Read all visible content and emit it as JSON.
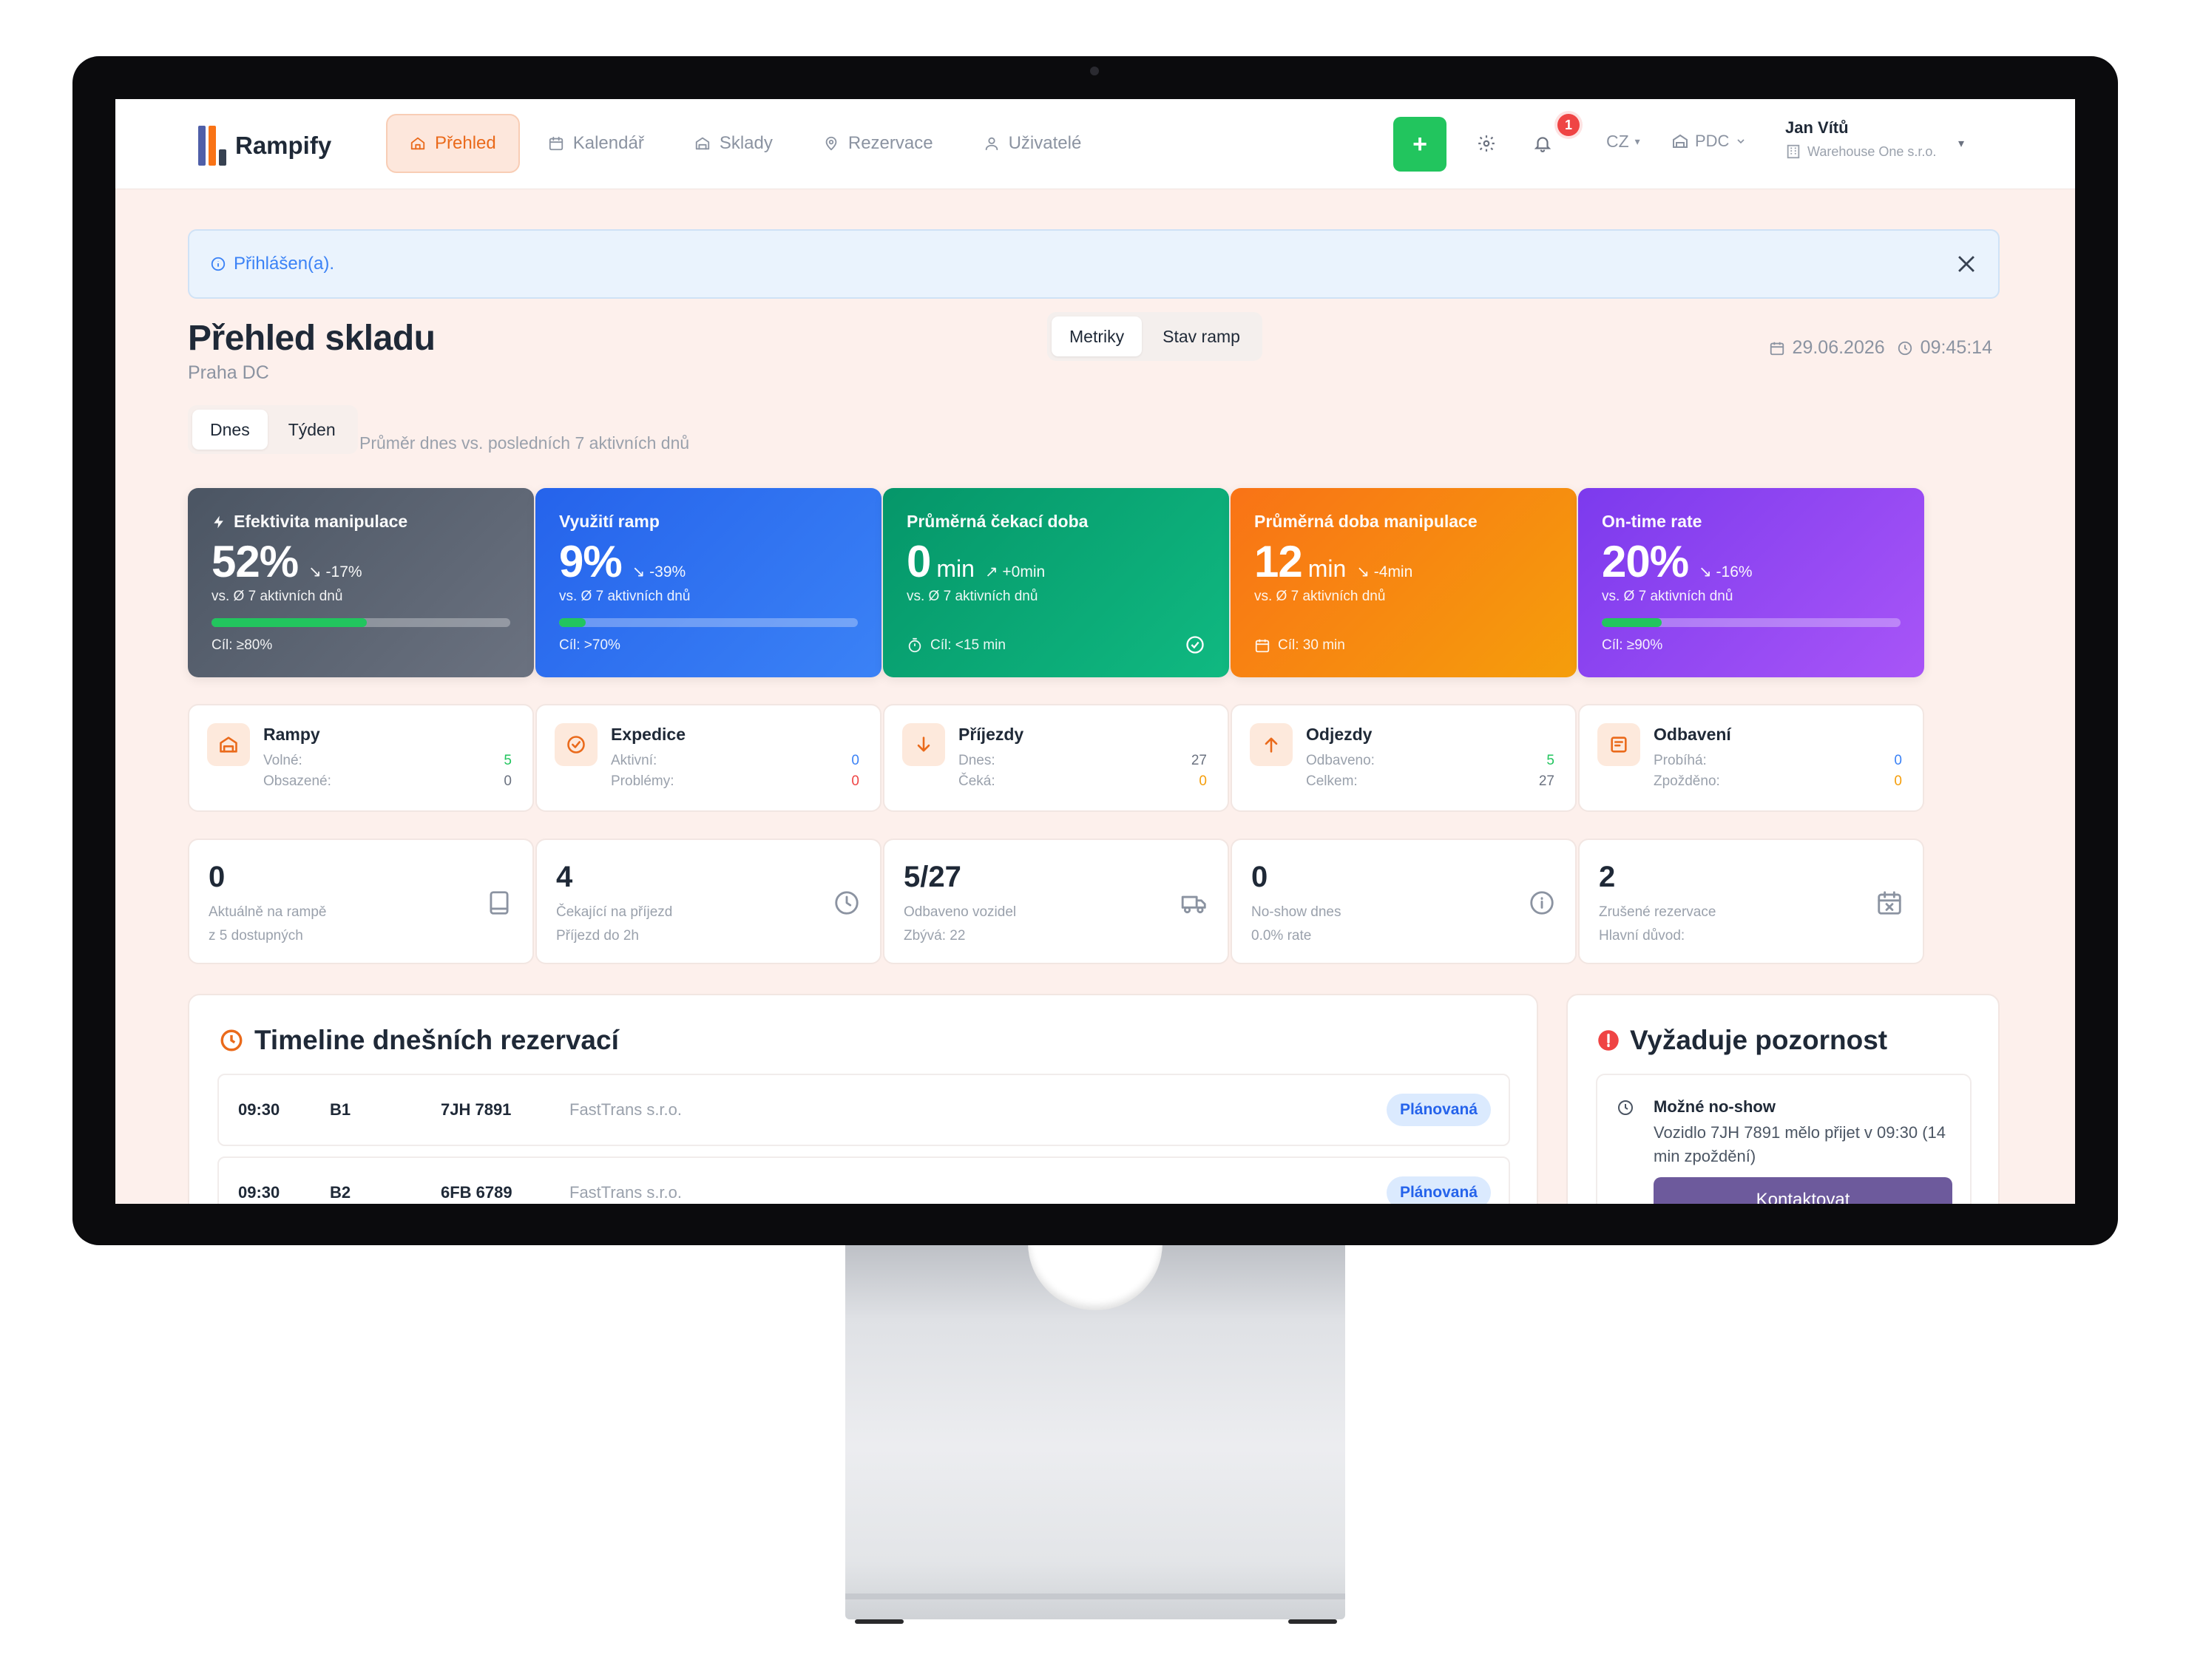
{
  "app": {
    "brand": "Rampify",
    "nav": [
      {
        "label": "Přehled",
        "icon": "home-icon",
        "active": true
      },
      {
        "label": "Kalendář",
        "icon": "calendar-icon",
        "active": false
      },
      {
        "label": "Sklady",
        "icon": "warehouse-icon",
        "active": false
      },
      {
        "label": "Rezervace",
        "icon": "map-pin-icon",
        "active": false
      },
      {
        "label": "Uživatelé",
        "icon": "user-icon",
        "active": false
      }
    ],
    "add_label": "+",
    "notifications_count": "1",
    "language": "CZ",
    "warehouse_code": "PDC",
    "user_name": "Jan Vítů",
    "user_company": "Warehouse One s.r.o."
  },
  "alert": {
    "text": "Přihlášen(a)."
  },
  "page": {
    "title": "Přehled skladu",
    "subtitle": "Praha DC",
    "view_tabs": [
      "Metriky",
      "Stav ramp"
    ],
    "date": "29.06.2026",
    "time": "09:45:14",
    "period_tabs": [
      "Dnes",
      "Týden"
    ],
    "period_note": "Průměr dnes vs. posledních 7 aktivních dnů"
  },
  "kpis": [
    {
      "title": "Efektivita manipulace",
      "value": "52%",
      "unit": "",
      "delta": "-17%",
      "trend": "down",
      "vs": "vs. Ø 7 aktivních dnů",
      "goal": "Cíl: ≥80%",
      "progress": 0.52,
      "color_from": "#4b5563",
      "color_to": "#6b7280"
    },
    {
      "title": "Využití ramp",
      "value": "9%",
      "unit": "",
      "delta": "-39%",
      "trend": "down",
      "vs": "vs. Ø 7 aktivních dnů",
      "goal": "Cíl: >70%",
      "progress": 0.09,
      "color_from": "#2563eb",
      "color_to": "#3b82f6"
    },
    {
      "title": "Průměrná čekací doba",
      "value": "0",
      "unit": "min",
      "delta": "+0min",
      "trend": "up",
      "vs": "vs. Ø 7 aktivních dnů",
      "goal": "Cíl: <15 min",
      "progress": null,
      "color_from": "#059669",
      "color_to": "#10b981"
    },
    {
      "title": "Průměrná doba manipulace",
      "value": "12",
      "unit": "min",
      "delta": "-4min",
      "trend": "down",
      "vs": "vs. Ø 7 aktivních dnů",
      "goal": "Cíl: 30 min",
      "progress": null,
      "color_from": "#f97316",
      "color_to": "#f59e0b"
    },
    {
      "title": "On-time rate",
      "value": "20%",
      "unit": "",
      "delta": "-16%",
      "trend": "down",
      "vs": "vs. Ø 7 aktivních dnů",
      "goal": "Cíl: ≥90%",
      "progress": 0.2,
      "color_from": "#7c3aed",
      "color_to": "#a855f7"
    }
  ],
  "stats": [
    {
      "title": "Rampy",
      "icon": "ramp-icon",
      "l1": "Volné:",
      "v1": "5",
      "c1": "#22c55e",
      "l2": "Obsazené:",
      "v2": "0",
      "c2": "#6b7280"
    },
    {
      "title": "Expedice",
      "icon": "check-circle-icon",
      "l1": "Aktivní:",
      "v1": "0",
      "c1": "#3b82f6",
      "l2": "Problémy:",
      "v2": "0",
      "c2": "#ef4444"
    },
    {
      "title": "Příjezdy",
      "icon": "arrow-down-icon",
      "l1": "Dnes:",
      "v1": "27",
      "c1": "#6b7280",
      "l2": "Čeká:",
      "v2": "0",
      "c2": "#f59e0b"
    },
    {
      "title": "Odjezdy",
      "icon": "arrow-up-icon",
      "l1": "Odbaveno:",
      "v1": "5",
      "c1": "#22c55e",
      "l2": "Celkem:",
      "v2": "27",
      "c2": "#6b7280"
    },
    {
      "title": "Odbavení",
      "icon": "clipboard-icon",
      "l1": "Probíhá:",
      "v1": "0",
      "c1": "#3b82f6",
      "l2": "Zpožděno:",
      "v2": "0",
      "c2": "#f59e0b"
    }
  ],
  "metrics": [
    {
      "value": "0",
      "l1": "Aktuálně na rampě",
      "l2": "z 5 dostupných",
      "icon": "tablet-icon"
    },
    {
      "value": "4",
      "l1": "Čekající na příjezd",
      "l2": "Příjezd do 2h",
      "icon": "clock-icon"
    },
    {
      "value": "5/27",
      "l1": "Odbaveno vozidel",
      "l2": "Zbývá: 22",
      "icon": "truck-icon"
    },
    {
      "value": "0",
      "l1": "No-show dnes",
      "l2": "0.0% rate",
      "icon": "info-icon"
    },
    {
      "value": "2",
      "l1": "Zrušené rezervace",
      "l2": "Hlavní důvod:",
      "icon": "calendar-x-icon"
    }
  ],
  "timeline": {
    "title": "Timeline dnešních rezervací",
    "rows": [
      {
        "time": "09:30",
        "ramp": "B1",
        "plate": "7JH 7891",
        "carrier": "FastTrans s.r.o.",
        "status": "Plánovaná"
      },
      {
        "time": "09:30",
        "ramp": "B2",
        "plate": "6FB 6789",
        "carrier": "FastTrans s.r.o.",
        "status": "Plánovaná"
      }
    ]
  },
  "attention": {
    "title": "Vyžaduje pozornost",
    "item_title": "Možné no-show",
    "item_text": "Vozidlo 7JH 7891 mělo přijet v 09:30 (14 min zpoždění)",
    "action": "Kontaktovat"
  }
}
